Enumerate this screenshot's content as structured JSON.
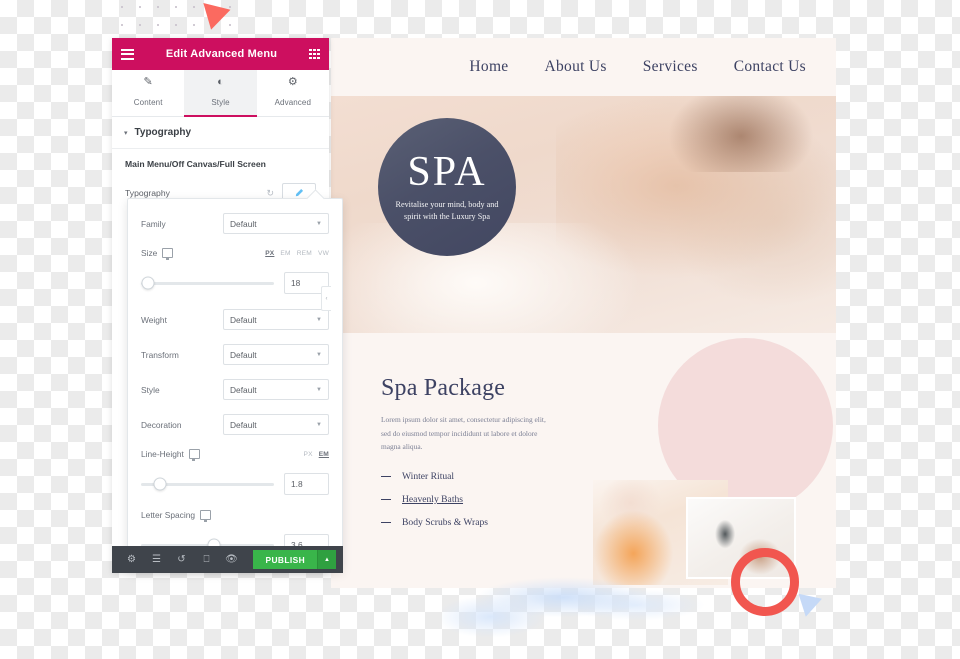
{
  "panel": {
    "header": {
      "title": "Edit Advanced Menu",
      "menu_icon": "hamburger-icon",
      "grid_icon": "grid-icon"
    },
    "tabs": [
      {
        "label": "Content",
        "icon": "pencil-icon",
        "active": false
      },
      {
        "label": "Style",
        "icon": "contrast-icon",
        "active": true
      },
      {
        "label": "Advanced",
        "icon": "gear-icon",
        "active": false
      }
    ],
    "section": {
      "title": "Typography",
      "caret": "▾"
    },
    "group_label": "Main Menu/Off Canvas/Full Screen",
    "typography_row": {
      "label": "Typography",
      "reset_icon": "reset-icon",
      "edit_icon": "pencil-icon"
    },
    "popup": {
      "family": {
        "label": "Family",
        "value": "Default"
      },
      "size": {
        "label": "Size",
        "device_icon": "monitor-icon",
        "units": [
          "PX",
          "EM",
          "REM",
          "VW"
        ],
        "active_unit": "PX",
        "value": "18",
        "knob_percent": 5
      },
      "weight": {
        "label": "Weight",
        "value": "Default"
      },
      "transform": {
        "label": "Transform",
        "value": "Default"
      },
      "style": {
        "label": "Style",
        "value": "Default"
      },
      "decoration": {
        "label": "Decoration",
        "value": "Default"
      },
      "line_height": {
        "label": "Line-Height",
        "device_icon": "monitor-icon",
        "units": [
          "PX",
          "EM"
        ],
        "active_unit": "EM",
        "value": "1.8",
        "knob_percent": 14
      },
      "letter_spacing": {
        "label": "Letter Spacing",
        "device_icon": "monitor-icon",
        "value": "3.6",
        "knob_percent": 55
      }
    },
    "footer": {
      "icons": [
        "gear-icon",
        "layers-icon",
        "history-icon",
        "responsive-icon",
        "preview-icon"
      ],
      "publish_label": "PUBLISH",
      "publish_caret": "▲",
      "publish_color": "#39b54a"
    },
    "collapse_handle": "‹",
    "accent_color": "#cd0f5f"
  },
  "site": {
    "nav": [
      {
        "label": "Home"
      },
      {
        "label": "About Us"
      },
      {
        "label": "Services"
      },
      {
        "label": "Contact Us"
      }
    ],
    "badge": {
      "word": "SPA",
      "tagline": "Revitalise your mind, body and spirit with the Luxury Spa"
    },
    "package": {
      "heading": "Spa Package",
      "lead": "Lorem ipsum dolor sit amet, consectetur adipiscing elit, sed do eiusmod tempor incididunt ut labore et dolore magna aliqua.",
      "items": [
        {
          "label": "Winter Ritual",
          "active": false
        },
        {
          "label": "Heavenly Baths",
          "active": true
        },
        {
          "label": "Body Scrubs & Wraps",
          "active": false
        }
      ]
    },
    "text_color": "#3d4263",
    "bg_color": "#fbf5f2"
  },
  "decorations": {
    "dot_grid": "dot-grid",
    "coral_triangle": "triangle-icon",
    "coral_ring": "ring-shape",
    "blue_triangle": "triangle-icon",
    "watercolor": "watercolor-brush",
    "pink_circle": "circle-shape"
  }
}
